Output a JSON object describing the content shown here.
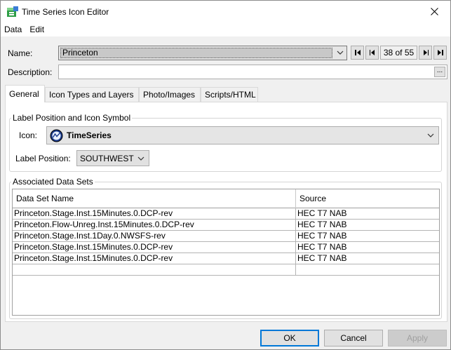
{
  "window": {
    "title": "Time Series Icon Editor"
  },
  "menu": {
    "items": [
      "Data",
      "Edit"
    ]
  },
  "fields": {
    "name_label": "Name:",
    "name_value": "Princeton",
    "record_counter": "38 of 55",
    "description_label": "Description:",
    "description_value": "",
    "description_button": "..."
  },
  "tabs": [
    "General",
    "Icon Types and Layers",
    "Photo/Images",
    "Scripts/HTML"
  ],
  "label_section": {
    "legend": "Label Position and Icon Symbol",
    "icon_label": "Icon:",
    "icon_value": "TimeSeries",
    "position_label": "Label Position:",
    "position_value": "SOUTHWEST"
  },
  "datasets": {
    "legend": "Associated Data Sets",
    "columns": [
      "Data Set Name",
      "Source"
    ],
    "rows": [
      [
        "Princeton.Stage.Inst.15Minutes.0.DCP-rev",
        "HEC T7 NAB"
      ],
      [
        "Princeton.Flow-Unreg.Inst.15Minutes.0.DCP-rev",
        "HEC T7 NAB"
      ],
      [
        "Princeton.Stage.Inst.1Day.0.NWSFS-rev",
        "HEC T7 NAB"
      ],
      [
        "Princeton.Stage.Inst.15Minutes.0.DCP-rev",
        "HEC T7 NAB"
      ],
      [
        "Princeton.Stage.Inst.15Minutes.0.DCP-rev",
        "HEC T7 NAB"
      ],
      [
        "",
        ""
      ]
    ]
  },
  "buttons": {
    "ok": "OK",
    "cancel": "Cancel",
    "apply": "Apply"
  },
  "colors": {
    "accent": "#0078d7",
    "selection": "#c8c8c8"
  }
}
